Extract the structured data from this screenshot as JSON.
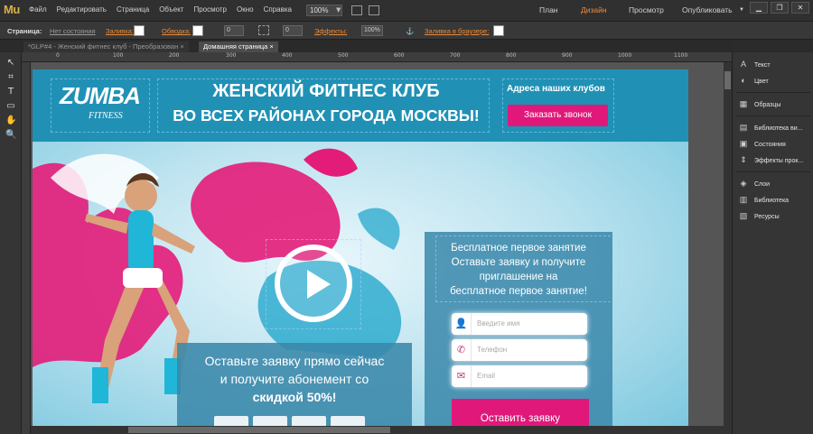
{
  "app": {
    "logo": "Mu"
  },
  "menu": [
    "Файл",
    "Редактировать",
    "Страница",
    "Объект",
    "Просмотр",
    "Окно",
    "Справка"
  ],
  "zoom": "100%",
  "modes": {
    "plan": "План",
    "design": "Дизайн",
    "preview": "Просмотр",
    "publish": "Опубликовать"
  },
  "propbar": {
    "page": "Страница:",
    "state": "Нет состояния",
    "fill": "Заливка:",
    "stroke": "Обводка:",
    "stroke_value": "0",
    "corner_value": "0",
    "effects": "Эффекты:",
    "opacity": "100%",
    "browser_fill": "Заливка в браузере:"
  },
  "tabs": [
    {
      "label": "*GLP#4 - Женский фитнес клуб - Преобразован ×"
    },
    {
      "label": "Домашняя страница ×"
    }
  ],
  "ruler": [
    "0",
    "100",
    "200",
    "300",
    "400",
    "500",
    "600",
    "700",
    "800",
    "900",
    "1000",
    "1100"
  ],
  "site": {
    "logo": "ZUMBA",
    "logo_sub": "FITNESS",
    "headline1": "ЖЕНСКИЙ ФИТНЕС КЛУБ",
    "headline2": "ВО ВСЕХ РАЙОНАХ ГОРОДА МОСКВЫ!",
    "addresses": "Адреса наших клубов",
    "call_button": "Заказать звонок",
    "form_title_1": "Бесплатное первое занятие",
    "form_title_2": "Оставьте заявку и получите",
    "form_title_3": "приглашение на",
    "form_title_4": "бесплатное первое занятие!",
    "name_placeholder": "Введите имя",
    "phone_placeholder": "Телефон",
    "email_placeholder": "Email",
    "submit": "Оставить заявку",
    "promo_1": "Оставьте заявку прямо сейчас",
    "promo_2": "и получите абонемент со",
    "promo_3": "скидкой 50%!"
  },
  "panel": [
    {
      "icon": "text-icon",
      "label": "Текст"
    },
    {
      "icon": "color-icon",
      "label": "Цвет"
    },
    {
      "icon": "swatches-icon",
      "label": "Образцы"
    },
    {
      "icon": "widgets-icon",
      "label": "Библиотека ви..."
    },
    {
      "icon": "states-icon",
      "label": "Состояния"
    },
    {
      "icon": "scroll-effects-icon",
      "label": "Эффекты прок..."
    },
    {
      "icon": "layers-icon",
      "label": "Слои"
    },
    {
      "icon": "library-icon",
      "label": "Библиотека"
    },
    {
      "icon": "assets-icon",
      "label": "Ресурсы"
    }
  ],
  "colors": {
    "accent": "#e0187a",
    "header": "#2091b5",
    "ui_orange": "#e88a3a"
  }
}
